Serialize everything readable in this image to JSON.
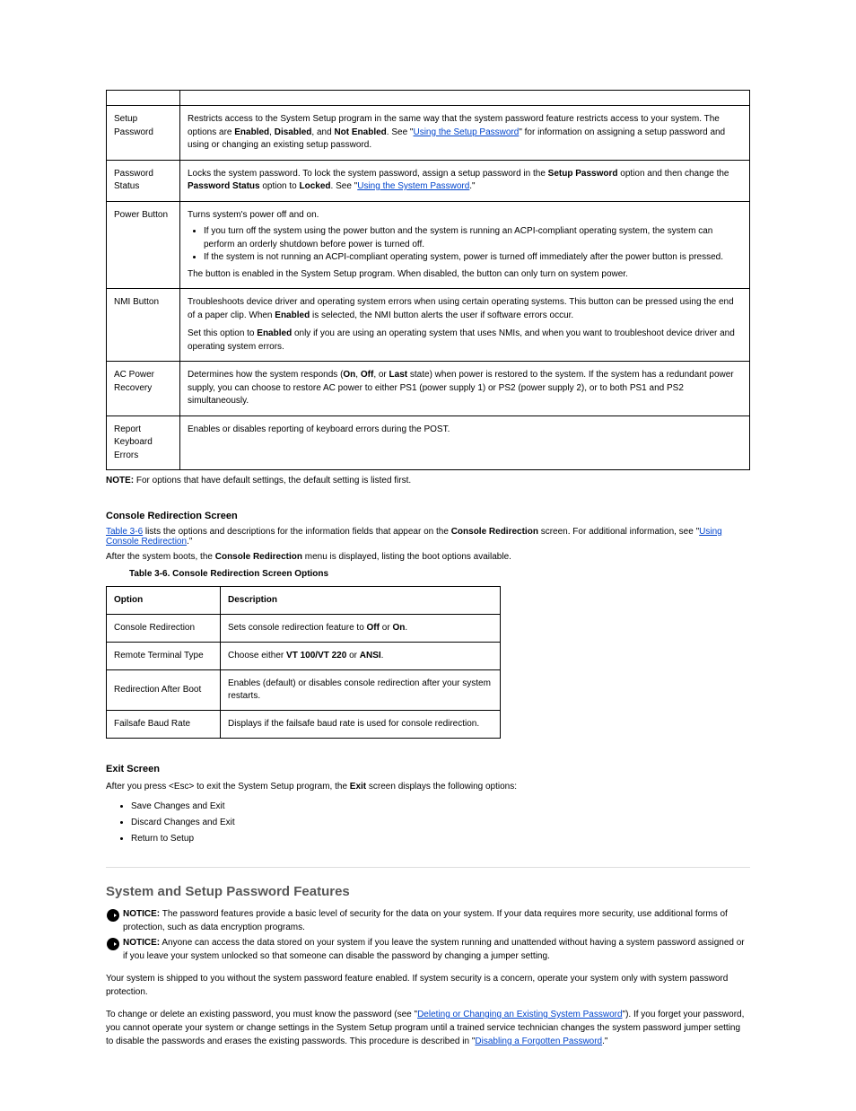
{
  "table_big": {
    "rows": [
      {
        "left": "",
        "right": ""
      },
      {
        "left": "Setup Password",
        "right_pre": "Restricts access to the System Setup program in the same way that the system password feature restricts access to your system. The options are ",
        "right_bold1": "Enabled",
        "right_mid": ", ",
        "right_bold2": "Disabled",
        "right_mid2": ", and ",
        "right_bold3": "Not Enabled",
        "right_post": ". See \"",
        "right_link_text": "Using the Setup Password",
        "right_post2": "\" for information on assigning a setup password and using or changing an existing setup password."
      },
      {
        "left": "Password Status",
        "right_pre": "Locks the system password. To lock the system password, assign a setup password in the ",
        "right_bold1": "Setup Password",
        "right_mid": " option and then change the ",
        "right_bold2": "Password Status",
        "right_mid2": " option to ",
        "right_bold3": "Locked",
        "right_post": ". See \"",
        "right_link_text": "Using the System Password",
        "right_post2": ".\""
      },
      {
        "left": "Power Button",
        "segments": [
          {
            "t": "Turns system's power off and on."
          },
          {
            "ul": [
              "If you turn off the system using the power button and the system is running an ACPI-compliant operating system, the system can perform an orderly shutdown before power is turned off.",
              "If the system is not running an ACPI-compliant operating system, power is turned off immediately after the power button is pressed."
            ]
          },
          {
            "t_pre": "The button is enabled in the System Setup program. When disabled, the button can only turn on system power.",
            "t_note": ""
          }
        ]
      },
      {
        "left": "NMI Button",
        "segments": [
          {
            "plain_pre": "Troubleshoots device driver and operating system errors when using certain operating systems. This button can be pressed using the end of a paper clip. When ",
            "b1": "Enabled",
            "mid": " is selected, the NMI button alerts the user if software errors occur.",
            "post": ""
          },
          {
            "plain_pre": "Set this option to ",
            "b1": "Enabled",
            "mid": " only if you are using an operating system that uses NMIs, and when you want to troubleshoot device driver and operating system errors.",
            "post": ""
          }
        ]
      },
      {
        "left": "AC Power Recovery",
        "right_plain_pre": "Determines how the system responds (",
        "opt1": "On",
        "sep1": ", ",
        "opt2": "Off",
        "sep2": ", or ",
        "opt3": "Last",
        "after": " state) when power is restored to the system. If the system has a redundant power supply, you can choose to restore AC power to either PS1 (power supply 1) or PS2 (power supply 2), or to both PS1 and PS2 simultaneously."
      },
      {
        "left": "Report Keyboard Errors",
        "right_plain": "Enables or disables reporting of keyboard errors during the POST."
      }
    ],
    "default_label": "NOTE:",
    "default_text": "For options that have default settings, the default setting is listed first."
  },
  "console_section": {
    "heading": "Console Redirection Screen",
    "help_pre": "",
    "table_link_text": "Table 3-6",
    "help_mid": " lists the options and descriptions for the information fields that appear on the ",
    "bold": "Console Redirection",
    "after_bold": " screen. For additional information, see \"",
    "link2_text": "Using Console Redirection",
    "after_link2": ".\"",
    "after_boot_pre": "After the system boots, the ",
    "after_boot_bold": "Console Redirection",
    "after_boot_post": " menu is displayed, listing the boot options available.",
    "caption": "Table 3-6. Console Redirection Screen Options"
  },
  "table_small": {
    "header": {
      "left": "Option",
      "right": "Description"
    },
    "rows": [
      {
        "left": "Console Redirection",
        "right_pre": "Sets console redirection feature to ",
        "b1": "Off",
        "mid": " or ",
        "b2": "On",
        "post": "."
      },
      {
        "left": "Remote Terminal Type",
        "right_pre": "Choose either ",
        "b1": "VT 100/VT 220",
        "mid": " or ",
        "b2": "ANSI",
        "post": "."
      },
      {
        "left": "Redirection After Boot",
        "right_pre": "Enables (default) or disables console redirection after your system restarts.",
        "b1": "",
        "mid": "",
        "b2": "",
        "post": ""
      },
      {
        "left": "Failsafe Baud Rate",
        "right_pre": "Displays if the failsafe baud rate is used for console redirection.",
        "b1": "",
        "mid": "",
        "b2": "",
        "post": ""
      }
    ]
  },
  "exit_section": {
    "heading": "Exit Screen",
    "intro_pre": "After you press <Esc> to exit the System Setup program, the ",
    "intro_bold": "Exit",
    "intro_post": " screen displays the following options:",
    "bullets": [
      "Save Changes and Exit",
      "Discard Changes and Exit",
      "Return to Setup"
    ]
  },
  "features_section": {
    "title": "System and Setup Password Features",
    "notice1_label": "NOTICE:",
    "notice1_text": "The password features provide a basic level of security for the data on your system. If your data requires more security, use additional forms of protection, such as data encryption programs.",
    "notice2_label": "NOTICE:",
    "notice2_text_pre": "Anyone can access the data stored on your system if you leave the system running and unattended without having a system password assigned or if you leave your system unlocked so that someone can disable the password by changing a jumper setting.",
    "body": "Your system is shipped to you without the system password feature enabled. If system security is a concern, operate your system only with system password protection.",
    "para2_pre": "To change or delete an existing password, you must know the password (see \"",
    "para2_link": "Deleting or Changing an Existing System Password",
    "para2_mid": "\"). If you forget your password, you cannot operate your system or change settings in the System Setup program until a trained service technician changes the system password jumper setting to disable the passwords and erases the existing passwords. This procedure is described in \"",
    "para2_link2": "Disabling a Forgotten Password",
    "para2_post": ".\""
  }
}
